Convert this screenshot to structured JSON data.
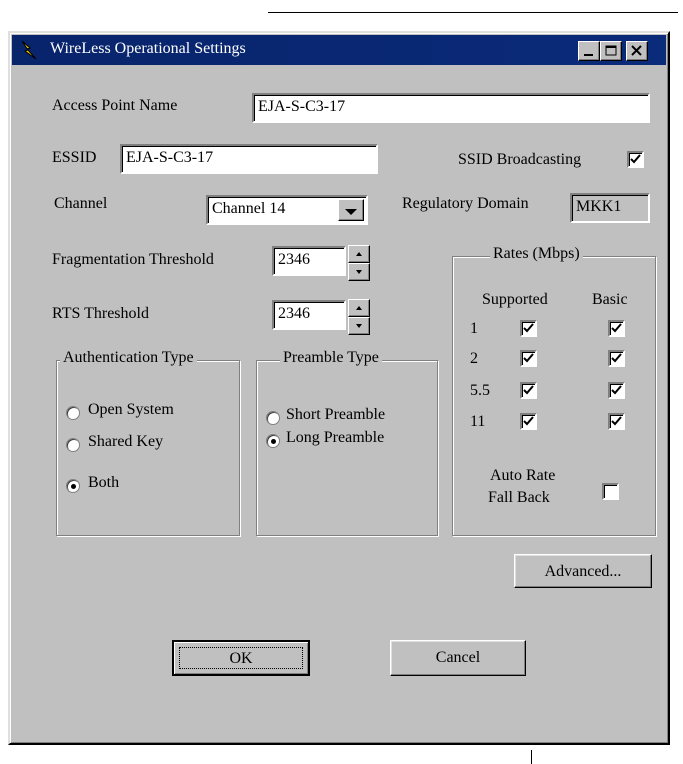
{
  "window": {
    "title": "WireLess Operational Settings"
  },
  "fields": {
    "access_point_name_label": "Access Point Name",
    "access_point_name_value": "EJA-S-C3-17",
    "essid_label": "ESSID",
    "essid_value": "EJA-S-C3-17",
    "ssid_broadcasting_label": "SSID Broadcasting",
    "ssid_broadcasting_checked": true,
    "channel_label": "Channel",
    "channel_value": "Channel 14",
    "regulatory_domain_label": "Regulatory Domain",
    "regulatory_domain_value": "MKK1",
    "fragmentation_threshold_label": "Fragmentation Threshold",
    "fragmentation_threshold_value": "2346",
    "rts_threshold_label": "RTS Threshold",
    "rts_threshold_value": "2346"
  },
  "authentication": {
    "title": "Authentication Type",
    "options": [
      {
        "label": "Open System",
        "selected": false
      },
      {
        "label": "Shared Key",
        "selected": false
      },
      {
        "label": "Both",
        "selected": true
      }
    ]
  },
  "preamble": {
    "title": "Preamble Type",
    "options": [
      {
        "label": "Short Preamble",
        "selected": false
      },
      {
        "label": "Long Preamble",
        "selected": true
      }
    ]
  },
  "rates": {
    "title": "Rates (Mbps)",
    "supported_header": "Supported",
    "basic_header": "Basic",
    "rows": [
      {
        "rate": "1",
        "supported": true,
        "basic": true
      },
      {
        "rate": "2",
        "supported": true,
        "basic": true
      },
      {
        "rate": "5.5",
        "supported": true,
        "basic": true
      },
      {
        "rate": "11",
        "supported": true,
        "basic": true
      }
    ],
    "auto_rate_label_line1": "Auto Rate",
    "auto_rate_label_line2": "Fall Back",
    "auto_rate_checked": false
  },
  "buttons": {
    "advanced": "Advanced...",
    "ok": "OK",
    "cancel": "Cancel"
  }
}
